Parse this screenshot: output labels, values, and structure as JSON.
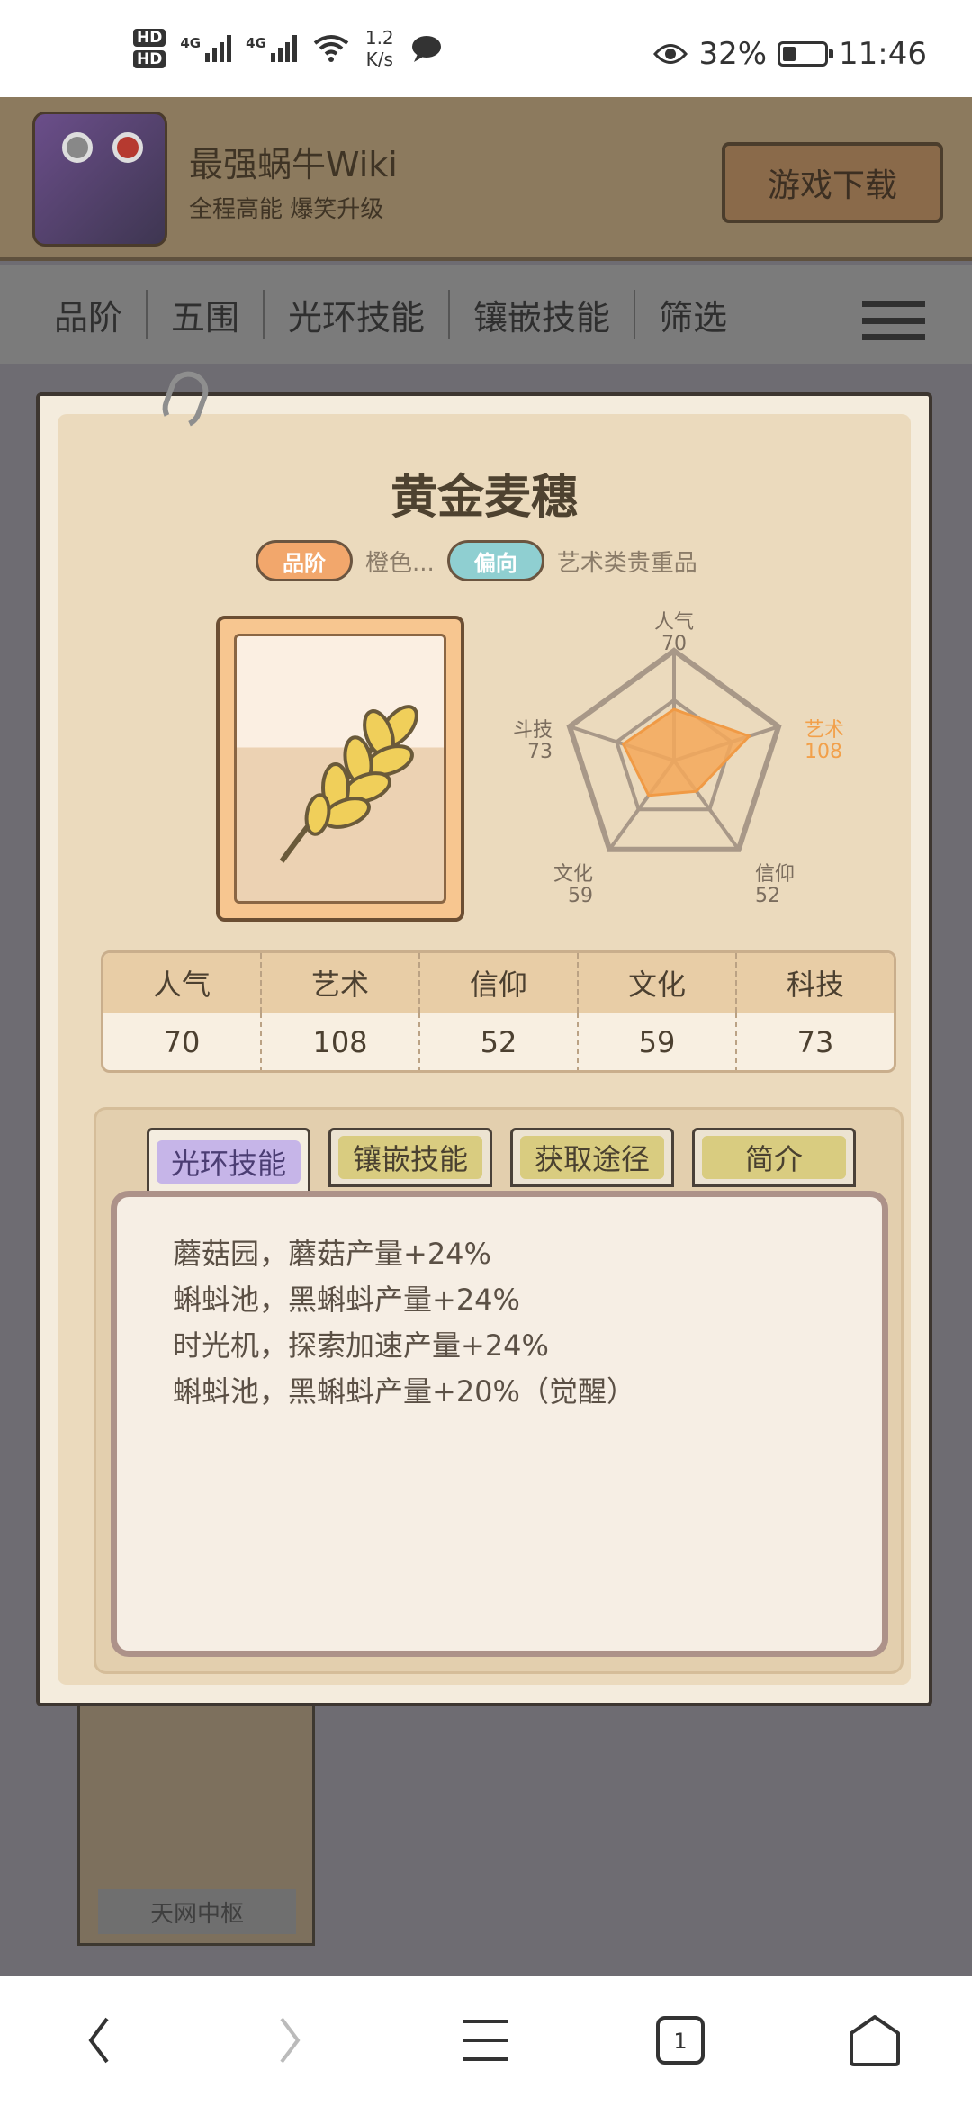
{
  "status_bar": {
    "network_speed_value": "1.2",
    "network_speed_unit": "K/s",
    "battery": "32%",
    "time": "11:46",
    "battery_level": 0.32,
    "hd1": "HD",
    "hd2": "HD",
    "sig1": "4G",
    "sig2": "4G"
  },
  "header": {
    "app_title": "最强蜗牛Wiki",
    "app_subtitle": "全程高能 爆笑升级",
    "download_button": "游戏下载"
  },
  "filters": [
    "品阶",
    "五围",
    "光环技能",
    "镶嵌技能",
    "筛选"
  ],
  "background_card": {
    "label": "天网中枢"
  },
  "item": {
    "name": "黄金麦穗",
    "tags": [
      {
        "pill": "品阶",
        "value": "橙色..."
      },
      {
        "pill": "偏向",
        "value": "艺术类贵重品"
      }
    ],
    "radar": [
      {
        "label": "人气",
        "value": 70
      },
      {
        "label": "艺术",
        "value": 108
      },
      {
        "label": "信仰",
        "value": 52
      },
      {
        "label": "文化",
        "value": 59
      },
      {
        "label": "科技",
        "value": 73
      }
    ],
    "radar_partial_labels": {
      "tech_visible": "斗技"
    },
    "stats_table": {
      "headers": [
        "人气",
        "艺术",
        "信仰",
        "文化",
        "科技"
      ],
      "values": [
        "70",
        "108",
        "52",
        "59",
        "73"
      ]
    },
    "tabs": [
      "光环技能",
      "镶嵌技能",
      "获取途径",
      "简介"
    ],
    "active_tab": "光环技能",
    "skills": [
      "蘑菇园，蘑菇产量+24%",
      "蝌蚪池，黑蝌蚪产量+24%",
      "时光机，探索加速产量+24%",
      "蝌蚪池，黑蝌蚪产量+20%（觉醒）"
    ]
  },
  "navbar": {
    "tabs_count": "1"
  },
  "colors": {
    "radar_fill": "#f5a85a",
    "highlight_label": "#f2a04a",
    "active_tab": "#c6b5e8"
  }
}
